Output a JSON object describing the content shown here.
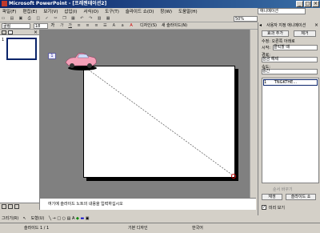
{
  "window": {
    "title": "Microsoft PowerPoint - [프레젠테이션2]"
  },
  "menu": [
    "파일(F)",
    "편집(E)",
    "보기(V)",
    "삽입(I)",
    "서식(O)",
    "도구(T)",
    "슬라이드 쇼(D)",
    "창(W)",
    "도움말(H)"
  ],
  "help_box": "애니메이션",
  "toolbar": {
    "zoom": "50%",
    "font": "굴림",
    "size": "18",
    "design_label": "디자인(S)",
    "new_slide_label": "새 슬라이드(N)"
  },
  "thumbnails": {
    "slide_number": "1"
  },
  "notes": {
    "placeholder": "여기에 슬라이드 노트의 내용을 입력하십시오"
  },
  "taskpane": {
    "title": "사용자 지정 애니메이션",
    "add_effect": "효과 추가",
    "remove": "제거",
    "modify_label": "수정: 오른쪽 아래로",
    "start_label": "시작:",
    "start_value": "클릭할 때",
    "path_label": "경로:",
    "path_value": "잠금 해제",
    "speed_label": "속도:",
    "speed_value": "중간",
    "list_item_number": "1",
    "list_item_label": "TNGKTHE...",
    "reorder_label": "순서 바꾸기",
    "play_button": "재생",
    "slideshow_button": "슬라이드 쇼",
    "autopreview_label": "미리 보기"
  },
  "drawing_toolbar": {
    "draw_label": "그리기(R)",
    "autoshapes_label": "도형(U)"
  },
  "status": {
    "slide": "슬라이드 1 / 1",
    "design": "기본 디자인",
    "language": "한국어"
  }
}
